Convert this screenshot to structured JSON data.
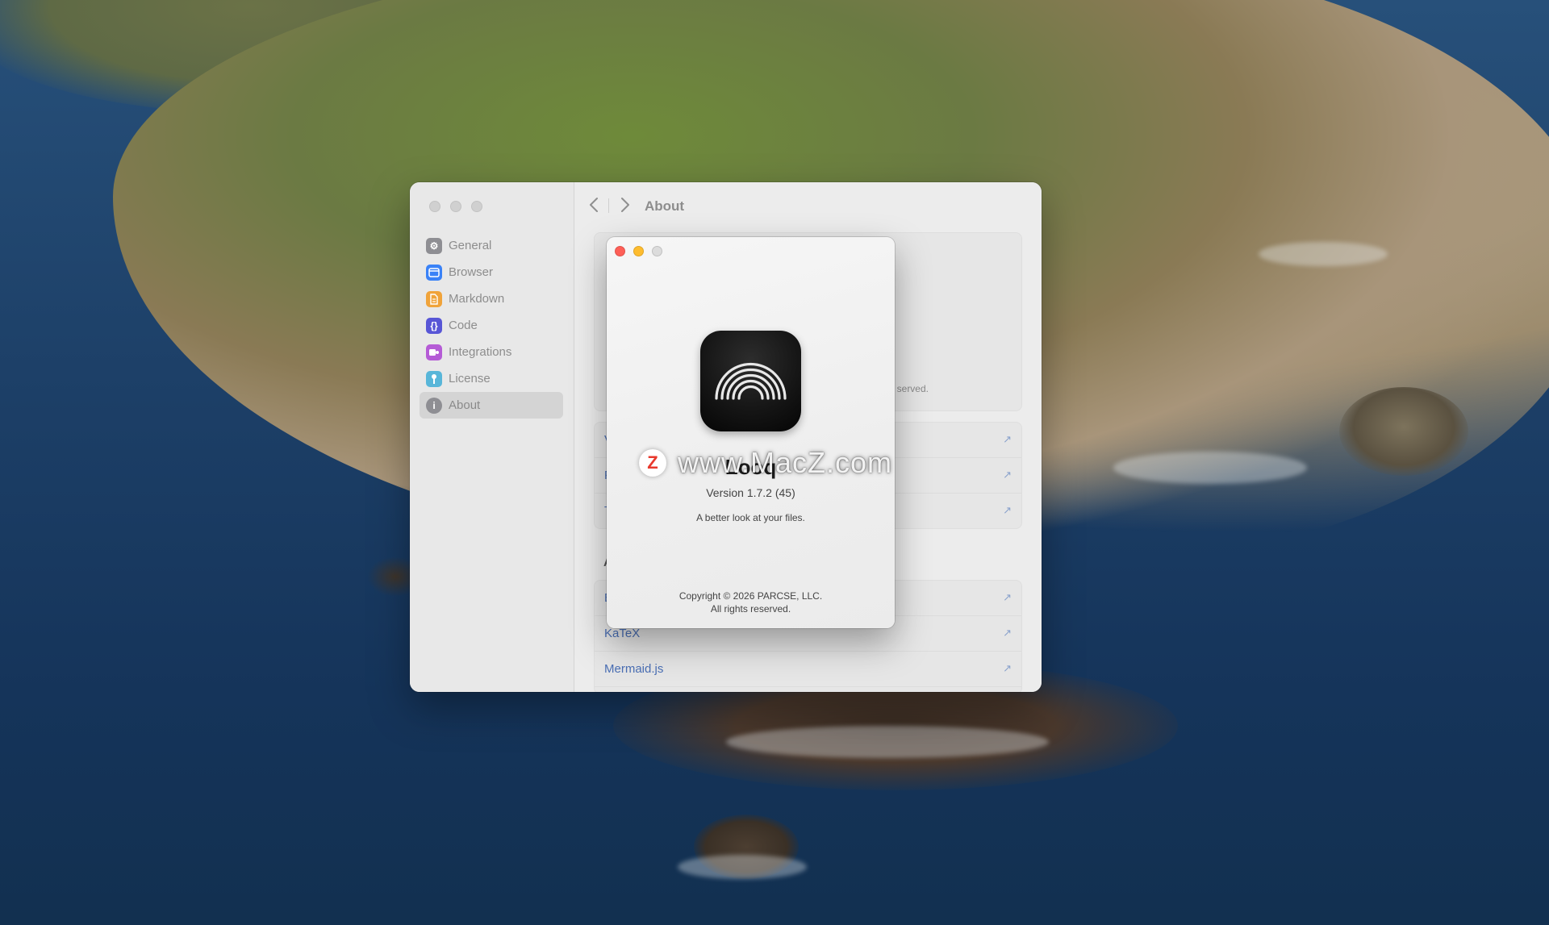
{
  "settings_window": {
    "toolbar_title": "About",
    "sidebar": {
      "items": [
        {
          "label": "General",
          "icon": "gear-icon",
          "color": "#8e8e93"
        },
        {
          "label": "Browser",
          "icon": "browser-window-icon",
          "color": "#3a82f7"
        },
        {
          "label": "Markdown",
          "icon": "document-icon",
          "color": "#f0a33a"
        },
        {
          "label": "Code",
          "icon": "braces-icon",
          "color": "#5856d6"
        },
        {
          "label": "Integrations",
          "icon": "puzzle-icon",
          "color": "#b55bd6"
        },
        {
          "label": "License",
          "icon": "key-icon",
          "color": "#58b6d9"
        },
        {
          "label": "About",
          "icon": "info-icon",
          "color": "#8e8e93",
          "selected": true
        }
      ]
    },
    "about_card": {
      "rights_fragment": "served."
    },
    "links": [
      {
        "label": "V"
      },
      {
        "label": "P"
      },
      {
        "label": "T"
      }
    ],
    "section_heading": "A",
    "acknowledgements": [
      {
        "label": "E"
      },
      {
        "label": "KaTeX"
      },
      {
        "label": "Mermaid.js"
      }
    ],
    "link_color": "#4a6fb5"
  },
  "about_panel": {
    "app_name": "Looq",
    "version": "Version 1.7.2 (45)",
    "tagline": "A better look at your files.",
    "copyright_line1": "Copyright © 2026 PARCSE, LLC.",
    "copyright_line2": "All rights reserved.",
    "icon": "rainbow-arcs-icon"
  },
  "watermark": {
    "logo_letter": "Z",
    "text": "www.MacZ.com"
  }
}
